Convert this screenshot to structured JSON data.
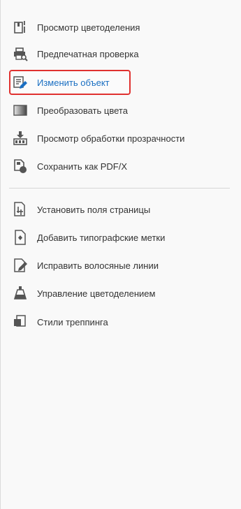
{
  "tools_panel": {
    "group1": [
      {
        "icon": "separations-preview-icon",
        "label": "Просмотр цветоделения"
      },
      {
        "icon": "preflight-icon",
        "label": "Предпечатная проверка"
      },
      {
        "icon": "edit-object-icon",
        "label": "Изменить объект",
        "selected": true
      },
      {
        "icon": "convert-colors-icon",
        "label": "Преобразовать цвета"
      },
      {
        "icon": "flattener-preview-icon",
        "label": "Просмотр обработки прозрачности"
      },
      {
        "icon": "save-pdfx-icon",
        "label": "Сохранить как PDF/X"
      }
    ],
    "group2": [
      {
        "icon": "set-page-boxes-icon",
        "label": "Установить поля страницы"
      },
      {
        "icon": "printer-marks-icon",
        "label": "Добавить типографские метки"
      },
      {
        "icon": "fix-hairlines-icon",
        "label": "Исправить волосяные линии"
      },
      {
        "icon": "ink-manager-icon",
        "label": "Управление цветоделением"
      },
      {
        "icon": "trap-presets-icon",
        "label": "Стили треппинга"
      }
    ]
  },
  "colors": {
    "selected_border": "#e0312f",
    "selected_text": "#1a6fc2",
    "text": "#333333",
    "background": "#f9f9f9"
  }
}
